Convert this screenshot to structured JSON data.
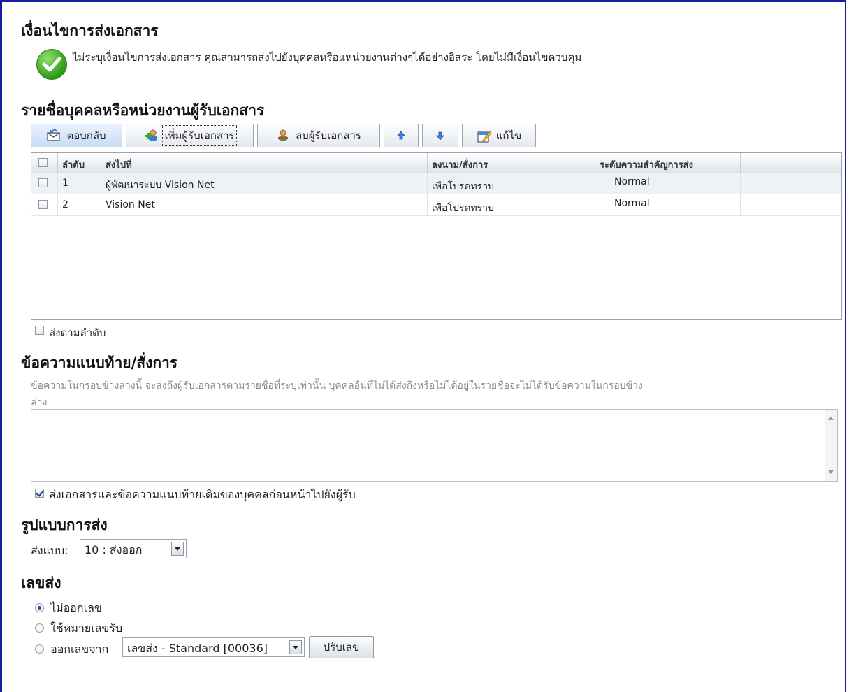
{
  "conditions": {
    "heading": "เงื่อนไขการส่งเอกสาร",
    "message": "ไม่ระบุเงื่อนไขการส่งเอกสาร คุณสามารถส่งไปยังบุคคลหรือแหน่วยงานต่างๆได้อย่างอิสระ โดยไม่มีเงื่อนไขควบคุม"
  },
  "recipients": {
    "heading": "รายชื่อบุคคลหรือหน่วยงานผู้รับเอกสาร",
    "toolbar": {
      "reply": "ตอบกลับ",
      "add": "เพิ่มผู้รับเอกสาร",
      "remove": "ลบผู้รับเอกสาร",
      "edit": "แก้ไข"
    },
    "columns": [
      "ลำดับ",
      "ส่งไปที่",
      "ลงนาม/สั่งการ",
      "ระดับความสำคัญการส่ง"
    ],
    "rows": [
      {
        "order": "1",
        "to": "ผู้พัฒนาระบบ Vision Net",
        "action": "เพื่อโปรดทราบ",
        "priority": "Normal"
      },
      {
        "order": "2",
        "to": "Vision Net",
        "action": "เพื่อโปรดทราบ",
        "priority": "Normal"
      }
    ],
    "send_in_order_label": "ส่งตามลำดับ"
  },
  "note": {
    "heading": "ข้อความแนบท้าย/สั่งการ",
    "hint_line1": "ข้อความในกรอบข้างล่างนี้ จะส่งถึงผู้รับเอกสารตามรายชื่อที่ระบุเท่านั้น บุคคลอื่นที่ไม่ได้ส่งถึงหรือไม่ได้อยู่ในรายชื่อจะไม่ได้รับข้อความในกรอบข้าง",
    "hint_line2": "ล่าง",
    "forward_label": "ส่งเอกสารและข้อความแนบท้ายเดิมของบุคคลก่อนหน้าไปยังผู้รับ"
  },
  "send_format": {
    "heading": "รูปแบบการส่ง",
    "label": "ส่งแบบ:",
    "selected": "10 : ส่งออก"
  },
  "send_number": {
    "heading": "เลขส่ง",
    "opt_none": "ไม่ออกเลข",
    "opt_receive": "ใช้หมายเลขรับ",
    "opt_from": "ออกเลขจาก",
    "selected": "เลขส่ง - Standard [00036]",
    "adjust": "ปรับเลข"
  }
}
